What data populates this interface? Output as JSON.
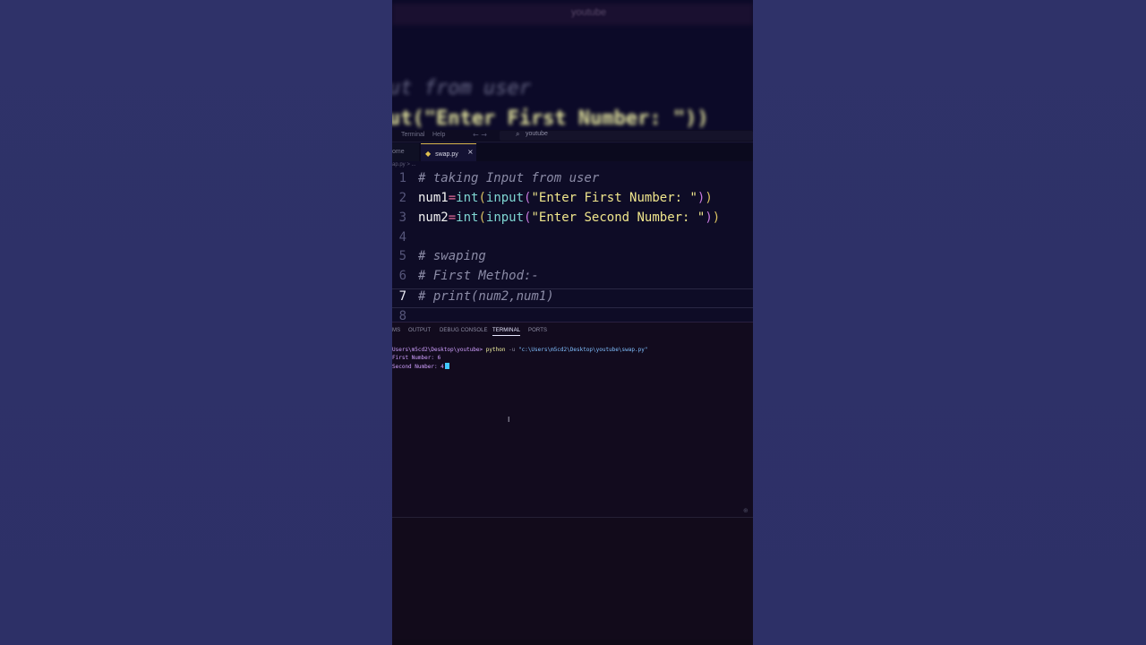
{
  "blurred_header": {
    "bar_text": "youtube",
    "line1": "ut from user",
    "line2": "ut(\"Enter First Number: \"))"
  },
  "titlebar": {
    "menu_terminal": "Terminal",
    "menu_help": "Help",
    "nav": "← →",
    "search_text": "youtube"
  },
  "tabs": {
    "home_label": "ome",
    "active_label": "swap.py",
    "close_glyph": "×"
  },
  "breadcrumb": "ap.py > ...",
  "editor": {
    "lines": [
      {
        "num": "1",
        "comment": "# taking Input from user"
      },
      {
        "num": "2",
        "var": "num1",
        "op": "=",
        "f1": "int",
        "p1": "(",
        "f2": "input",
        "p2": "(",
        "str": "\"Enter First Number: \"",
        "p3": ")",
        "p4": ")"
      },
      {
        "num": "3",
        "var": "num2",
        "op": "=",
        "f1": "int",
        "p1": "(",
        "f2": "input",
        "p2": "(",
        "str": "\"Enter Second Number: \"",
        "p3": ")",
        "p4": ")"
      },
      {
        "num": "4"
      },
      {
        "num": "5",
        "comment": "# swaping"
      },
      {
        "num": "6",
        "comment": "# First Method:-"
      },
      {
        "num": "7",
        "comment": "# print(num2,num1)"
      },
      {
        "num": "8"
      }
    ],
    "active_line": "7"
  },
  "panel": {
    "tabs": [
      "MS",
      "OUTPUT",
      "DEBUG CONSOLE",
      "TERMINAL",
      "PORTS"
    ],
    "active_tab": "TERMINAL",
    "terminal": {
      "prompt_path": "Users\\m5cd2\\Desktop\\youtube>",
      "cmd": "python",
      "flag": "-u",
      "arg": "\"c:\\Users\\m5cd2\\Desktop\\youtube\\swap.py\"",
      "out1": "First Number: 6",
      "out2": "Second Number: 4"
    }
  },
  "colors": {
    "background": "#2e3168",
    "editor_bg": "#0e0c26",
    "terminal_bg": "#120b1e",
    "tab_accent": "#d9b64d",
    "cursor": "#41c8ff"
  }
}
